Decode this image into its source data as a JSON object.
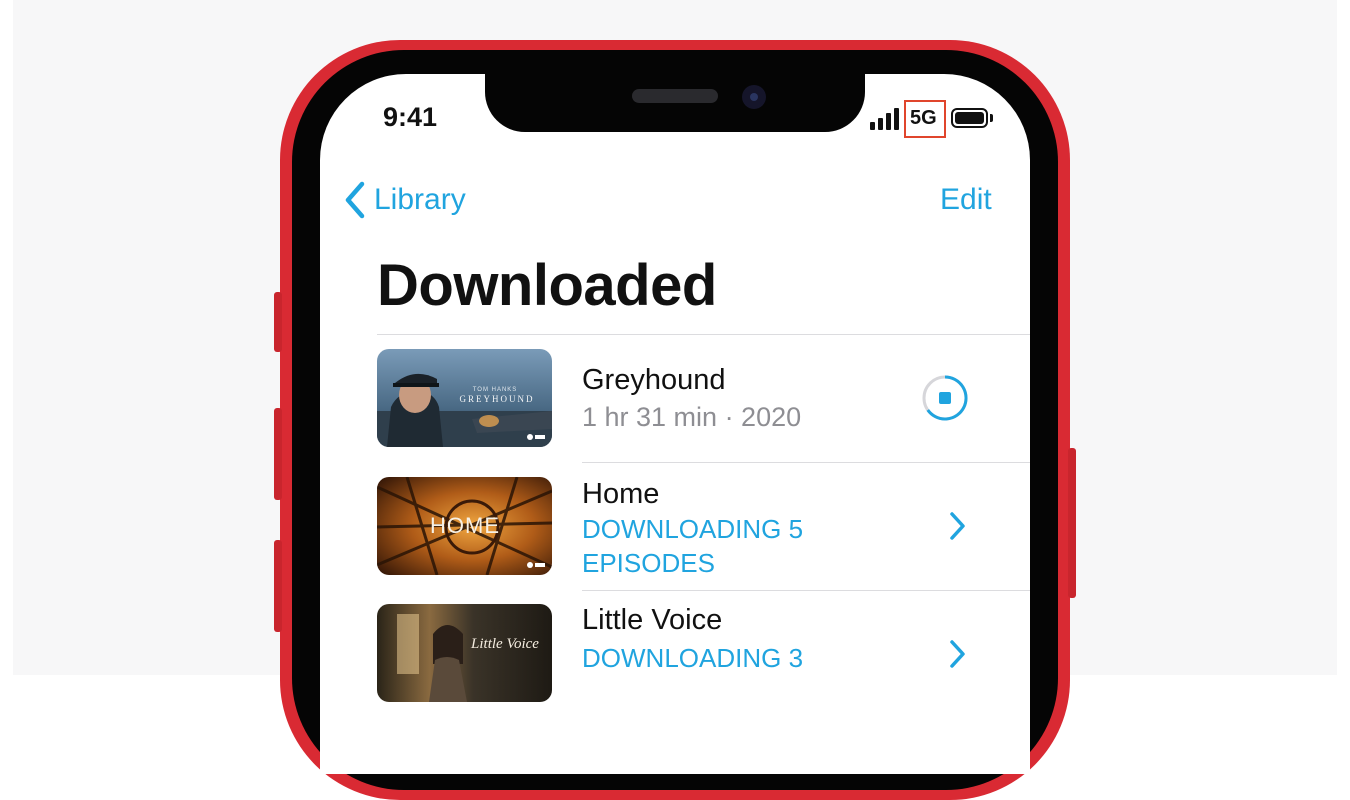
{
  "status_bar": {
    "time": "9:41",
    "network": "5G",
    "icons": [
      "cellular-signal-icon",
      "battery-icon"
    ]
  },
  "nav": {
    "back_label": "Library",
    "edit_label": "Edit"
  },
  "page": {
    "title": "Downloaded"
  },
  "items": [
    {
      "title": "Greyhound",
      "subtitle": "1 hr 31 min · 2020",
      "thumbnail_text": "GREYHOUND",
      "thumbnail_small": "TOM HANKS",
      "action": "stop-download-icon"
    },
    {
      "title": "Home",
      "status": "DOWNLOADING 5 EPISODES",
      "thumbnail_text": "HOME",
      "action": "chevron-right-icon"
    },
    {
      "title": "Little Voice",
      "status": "DOWNLOADING 3",
      "thumbnail_text": "Little Voice",
      "action": "chevron-right-icon"
    }
  ],
  "colors": {
    "accent": "#20a4df",
    "frame": "#d92a33",
    "highlight_box": "#e0452c"
  }
}
